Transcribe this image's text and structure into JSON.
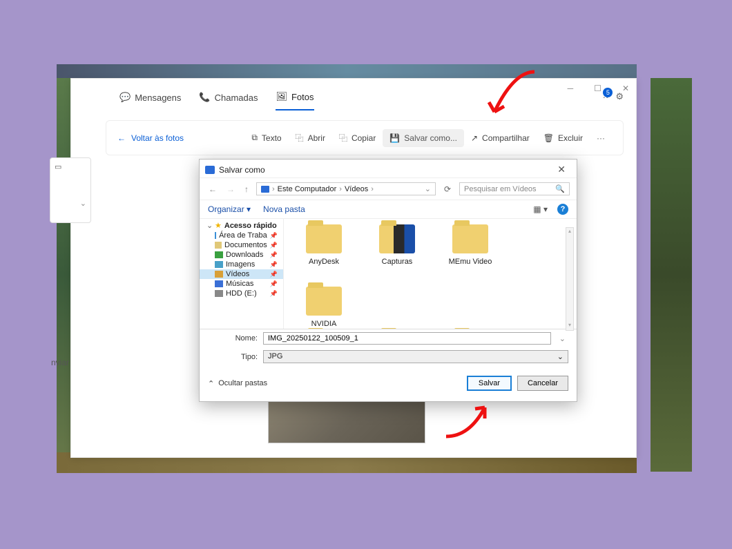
{
  "app": {
    "tabs": {
      "messages": "Mensagens",
      "calls": "Chamadas",
      "photos": "Fotos"
    },
    "notification_count": "5",
    "photo_toolbar": {
      "back": "Voltar às fotos",
      "text": "Texto",
      "open": "Abrir",
      "copy": "Copiar",
      "save_as": "Salvar como...",
      "share": "Compartilhar",
      "delete": "Excluir",
      "more": "···"
    },
    "send_fragment": "nviar"
  },
  "dialog": {
    "title": "Salvar como",
    "breadcrumb": {
      "root": "Este Computador",
      "folder": "Vídeos"
    },
    "search_placeholder": "Pesquisar em Vídeos",
    "organize": "Organizar",
    "new_folder": "Nova pasta",
    "help": "?",
    "tree": {
      "quick_access": "Acesso rápido",
      "desktop": "Área de Traba",
      "documents": "Documentos",
      "downloads": "Downloads",
      "images": "Imagens",
      "videos": "Vídeos",
      "music": "Músicas",
      "hdd": "HDD (E:)"
    },
    "folders": {
      "anydesk": "AnyDesk",
      "capturas": "Capturas",
      "memu": "MEmu Video",
      "nvidia": "NVIDIA"
    },
    "name_label": "Nome:",
    "name_value": "IMG_20250122_100509_1",
    "type_label": "Tipo:",
    "type_value": "JPG",
    "hide_folders": "Ocultar pastas",
    "save_btn": "Salvar",
    "cancel_btn": "Cancelar"
  }
}
